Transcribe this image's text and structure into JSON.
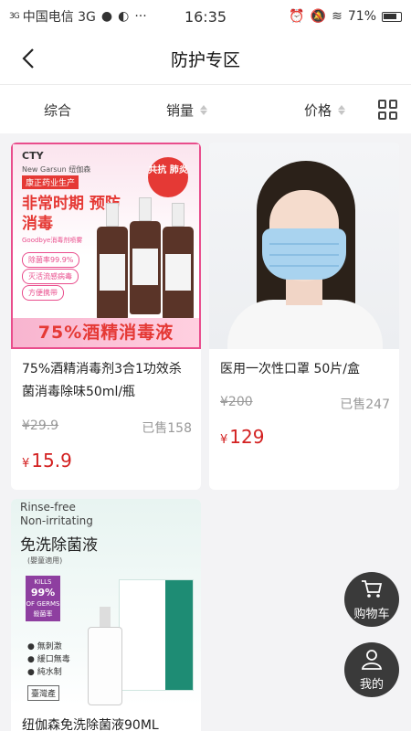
{
  "status_bar": {
    "signal": "3G",
    "carrier": "中国电信 3G",
    "time": "16:35",
    "battery": "71%"
  },
  "header": {
    "title": "防护专区"
  },
  "sort_bar": {
    "items": [
      {
        "label": "综合"
      },
      {
        "label": "销量"
      },
      {
        "label": "价格"
      }
    ]
  },
  "products": [
    {
      "name": "75%酒精消毒剂3合1功效杀菌消毒除味50ml/瓶",
      "original_price": "¥29.9",
      "sold": "已售158",
      "price": "15.9",
      "currency": "¥",
      "image": {
        "brand": "CTY",
        "brand_sub": "New Garsun 纽伽森",
        "maker": "康正药业生产",
        "headline": "非常时期 预防消毒",
        "subline": "Goodbye消毒剂喷雾",
        "badge": "共抗 肺炎",
        "features": [
          "除菌率99.9%",
          "灭活流感病毒",
          "方便携带"
        ],
        "banner": "75%酒精消毒液"
      }
    },
    {
      "name": "医用一次性口罩 50片/盒",
      "original_price": "¥200",
      "sold": "已售247",
      "price": "129",
      "currency": "¥"
    },
    {
      "name": "纽伽森免洗除菌液90ML",
      "image": {
        "en1": "Rinse-free",
        "en2": "Non-irritating",
        "cn": "免洗除菌液",
        "cn_sub": "(嬰童適用)",
        "kills_line1": "KILLS",
        "kills_line2": "99%",
        "kills_line3": "OF GERMS",
        "kills_line4": "殺菌率",
        "features": [
          "● 無刺激",
          "● 緩口無毒",
          "● 純水制"
        ],
        "origin": "臺灣產"
      }
    }
  ],
  "floating": {
    "cart_label": "购物车",
    "profile_label": "我的"
  }
}
